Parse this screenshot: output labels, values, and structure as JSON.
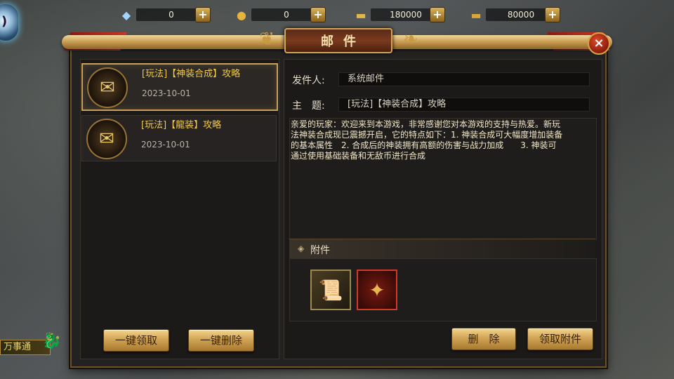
{
  "resources": [
    {
      "icon": "diamond-icon",
      "glyph": "◆",
      "value": "0"
    },
    {
      "icon": "gold-coin-icon",
      "glyph": "●",
      "value": "0"
    },
    {
      "icon": "gold-ingot-icon",
      "glyph": "▬",
      "value": "180000"
    },
    {
      "icon": "bound-ingot-icon",
      "glyph": "▬",
      "value": "80000"
    }
  ],
  "plus_label": "+",
  "window": {
    "title": "邮件",
    "close": "×"
  },
  "mail_list": [
    {
      "title": "[玩法]【神装合成】攻略",
      "date": "2023-10-01",
      "selected": true
    },
    {
      "title": "[玩法]【龍装】攻略",
      "date": "2023-10-01",
      "selected": false
    }
  ],
  "detail": {
    "sender_label": "发件人:",
    "sender": "系统邮件",
    "subject_label": "主　题:",
    "subject": "[玩法]【神装合成】攻略",
    "body": "亲爱的玩家：欢迎来到本游戏，非常感谢您对本游戏的支持与热爱。新玩法神装合成现已震撼开启，它的特点如下：1. 神装合成可大幅度增加装备的基本属性　2. 合成后的神装拥有高额的伤害与战力加成　　3. 神装可通过使用基础装备和无敌币进行合成",
    "attach_label": "附件"
  },
  "buttons": {
    "claim_all": "一键领取",
    "delete_all": "一键删除",
    "delete": "删　除",
    "claim_attach": "领取附件"
  },
  "side": {
    "wan_label": "万事通"
  }
}
